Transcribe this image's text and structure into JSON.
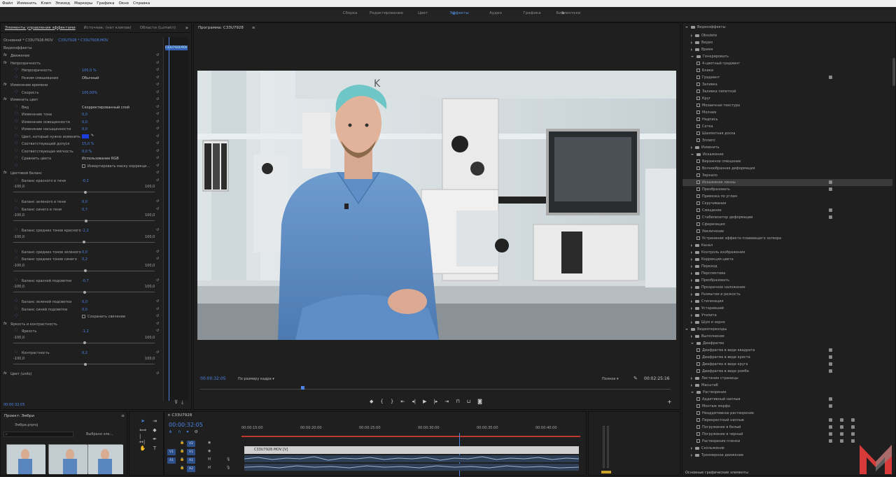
{
  "menu": [
    "Файл",
    "Изменить",
    "Клип",
    "Эпизод",
    "Маркеры",
    "Графика",
    "Окно",
    "Справка"
  ],
  "workspaces": [
    "Сборка",
    "Редактирование",
    "Цвет",
    "Эффекты",
    "Аудио",
    "Графика",
    "Библиотеки"
  ],
  "active_workspace": "Эффекты",
  "effects_panel": {
    "tabs": [
      "Элементы управления эффектами",
      "Источник: (нет клипов)",
      "Области (Lumetri)"
    ],
    "source_label": "Основной * C33U7928.MOV",
    "clip_label": "C33U7928 * C33U7928.MOV",
    "timeline_clip": "C33U7928.MOV",
    "timecode": "00:00:32:05",
    "section_title": "Видеоэффекты",
    "items": [
      {
        "label": "Движение",
        "type": "fx"
      },
      {
        "label": "Непрозрачность",
        "type": "fx"
      },
      {
        "label": "Непрозрачность",
        "value": "100,0 %",
        "type": "param"
      },
      {
        "label": "Режим смешивания",
        "value": "Обычный",
        "type": "select"
      },
      {
        "label": "Изменение времени",
        "type": "fx"
      },
      {
        "label": "Скорость",
        "value": "100,00%",
        "type": "param"
      },
      {
        "label": "Изменить цвет",
        "type": "fx"
      },
      {
        "label": "Вид",
        "value": "Скорректированный слой",
        "type": "select"
      },
      {
        "label": "Изменение тона",
        "value": "0,0",
        "type": "param"
      },
      {
        "label": "Изменение освещенности",
        "value": "0,0",
        "type": "param"
      },
      {
        "label": "Изменение насыщенности",
        "value": "0,0",
        "type": "param"
      },
      {
        "label": "Цвет, который нужно изменить",
        "value": "",
        "type": "color"
      },
      {
        "label": "Соответствующий допуск",
        "value": "15,0 %",
        "type": "param"
      },
      {
        "label": "Соответствующая мягкость",
        "value": "0,0 %",
        "type": "param"
      },
      {
        "label": "Сравнить цвета",
        "value": "Использование RGB",
        "type": "select"
      },
      {
        "label": "Инвертировать маску коррекци...",
        "value": "",
        "type": "check"
      },
      {
        "label": "Цветовой баланс",
        "type": "fx"
      },
      {
        "label": "Баланс красного в тени",
        "value": "-0,2",
        "type": "slider"
      },
      {
        "label": "Баланс зеленого в тени",
        "value": "0,0",
        "type": "param"
      },
      {
        "label": "Баланс синего в тени",
        "value": "0,7",
        "type": "slider"
      },
      {
        "label": "Баланс средних тонов красного",
        "value": "-2,2",
        "type": "slider"
      },
      {
        "label": "Баланс средних тонов зеленого",
        "value": "0,0",
        "type": "param"
      },
      {
        "label": "Баланс средних тонов синего",
        "value": "0,2",
        "type": "slider"
      },
      {
        "label": "Баланс красной подсветки",
        "value": "-0,7",
        "type": "slider"
      },
      {
        "label": "Баланс зеленой подсветки",
        "value": "0,0",
        "type": "param"
      },
      {
        "label": "Баланс синей подсветки",
        "value": "0,0",
        "type": "param"
      },
      {
        "label": "Сохранить свечение",
        "value": "",
        "type": "check"
      },
      {
        "label": "Яркость и контрастность",
        "type": "fx"
      },
      {
        "label": "Яркость",
        "value": "-1,2",
        "type": "slider"
      },
      {
        "label": "Контрастность",
        "value": "0,2",
        "type": "slider"
      },
      {
        "label": "Цвет (units)",
        "type": "fx"
      }
    ],
    "slider_min": "-100,0",
    "slider_max": "100,0"
  },
  "program_monitor": {
    "title": "Программа: C33U7928",
    "timecode": "00:00:32:05",
    "fit": "По размеру кадра",
    "quality": "Полное",
    "duration": "00:02:25:16"
  },
  "effects_library": {
    "root_video": "Видеоэффекты",
    "items": [
      {
        "label": "Obsolete",
        "level": 1,
        "folder": true
      },
      {
        "label": "Видео",
        "level": 1,
        "folder": true
      },
      {
        "label": "Время",
        "level": 1,
        "folder": true
      },
      {
        "label": "Генерировать",
        "level": 1,
        "folder": true,
        "open": true
      },
      {
        "label": "4-цветный градиент",
        "level": 2
      },
      {
        "label": "Блики",
        "level": 2
      },
      {
        "label": "Градиент",
        "level": 2,
        "badge": true
      },
      {
        "label": "Заливка",
        "level": 2
      },
      {
        "label": "Заливка пипеткой",
        "level": 2
      },
      {
        "label": "Круг",
        "level": 2
      },
      {
        "label": "Мозаичная текстура",
        "level": 2
      },
      {
        "label": "Молния",
        "level": 2
      },
      {
        "label": "Надпись",
        "level": 2
      },
      {
        "label": "Сетка",
        "level": 2
      },
      {
        "label": "Шахматная доска",
        "level": 2
      },
      {
        "label": "Эллипс",
        "level": 2
      },
      {
        "label": "Изменить",
        "level": 1,
        "folder": true
      },
      {
        "label": "Искажение",
        "level": 1,
        "folder": true,
        "open": true
      },
      {
        "label": "Виражное смещение",
        "level": 2
      },
      {
        "label": "Волнообразная деформация",
        "level": 2
      },
      {
        "label": "Зеркало",
        "level": 2
      },
      {
        "label": "Искажение линзы",
        "level": 2,
        "badge": true,
        "selected": true
      },
      {
        "label": "Преобразовать",
        "level": 2,
        "badge": true
      },
      {
        "label": "Привязка по углам",
        "level": 2
      },
      {
        "label": "Скручивание",
        "level": 2
      },
      {
        "label": "Смещение",
        "level": 2,
        "badge": true
      },
      {
        "label": "Стабилизатор деформации",
        "level": 2,
        "badge": true
      },
      {
        "label": "Сферизация",
        "level": 2
      },
      {
        "label": "Увеличение",
        "level": 2
      },
      {
        "label": "Устранение эффекта плавающего затвора",
        "level": 2
      },
      {
        "label": "Канал",
        "level": 1,
        "folder": true
      },
      {
        "label": "Контроль изображения",
        "level": 1,
        "folder": true
      },
      {
        "label": "Коррекция цвета",
        "level": 1,
        "folder": true
      },
      {
        "label": "Переход",
        "level": 1,
        "folder": true
      },
      {
        "label": "Перспектива",
        "level": 1,
        "folder": true
      },
      {
        "label": "Преобразовать",
        "level": 1,
        "folder": true
      },
      {
        "label": "Прозрачное наложение",
        "level": 1,
        "folder": true
      },
      {
        "label": "Размытие и резкость",
        "level": 1,
        "folder": true
      },
      {
        "label": "Стилизация",
        "level": 1,
        "folder": true
      },
      {
        "label": "Устаревший",
        "level": 1,
        "folder": true
      },
      {
        "label": "Утилита",
        "level": 1,
        "folder": true
      },
      {
        "label": "Шум и зерно",
        "level": 1,
        "folder": true
      },
      {
        "label": "Видеопереходы",
        "level": 0,
        "folder": true,
        "open": true
      },
      {
        "label": "Выполнение",
        "level": 1,
        "folder": true
      },
      {
        "label": "Диафрагма",
        "level": 1,
        "folder": true,
        "open": true
      },
      {
        "label": "Диафрагма в виде квадрата",
        "level": 2,
        "badge": true
      },
      {
        "label": "Диафрагма в виде креста",
        "level": 2,
        "badge": true
      },
      {
        "label": "Диафрагма в виде круга",
        "level": 2,
        "badge": true
      },
      {
        "label": "Диафрагма в виде ромба",
        "level": 2,
        "badge": true
      },
      {
        "label": "Листание страницы",
        "level": 1,
        "folder": true
      },
      {
        "label": "Масштаб",
        "level": 1,
        "folder": true
      },
      {
        "label": "Растворение",
        "level": 1,
        "folder": true,
        "open": true
      },
      {
        "label": "Аддитивный наплыв",
        "level": 2,
        "badge": true
      },
      {
        "label": "Монтаж морфа",
        "level": 2,
        "badge": true
      },
      {
        "label": "Неаддитивное растворение",
        "level": 2
      },
      {
        "label": "Перекрестный наплыв",
        "level": 2,
        "badge3": true
      },
      {
        "label": "Погружение в белый",
        "level": 2,
        "badge3": true
      },
      {
        "label": "Погружение в черный",
        "level": 2,
        "badge3": true
      },
      {
        "label": "Растворение пленки",
        "level": 2,
        "badge3": true
      },
      {
        "label": "Скольжение",
        "level": 1,
        "folder": true
      },
      {
        "label": "Трехмерное движение",
        "level": 1,
        "folder": true
      }
    ],
    "footer": "Основные графические элементы"
  },
  "project": {
    "title": "Проект: Эмбри",
    "bin": "Эмбри.prproj",
    "selected": "Выбрано эле..."
  },
  "timeline": {
    "title": "C33U7928",
    "timecode": "00:00:32:05",
    "ruler": [
      "00:00:15:00",
      "00:00:20:00",
      "00:00:25:00",
      "00:00:30:00",
      "00:00:35:00",
      "00:00:40:00"
    ],
    "tracks": [
      "V2",
      "V1",
      "A1",
      "A2"
    ],
    "clip_label": "C33U7928.MOV [V]"
  },
  "colors": {
    "accent": "#4d84e4",
    "background": "#1d1d1d",
    "logo": "#d83a3a"
  }
}
